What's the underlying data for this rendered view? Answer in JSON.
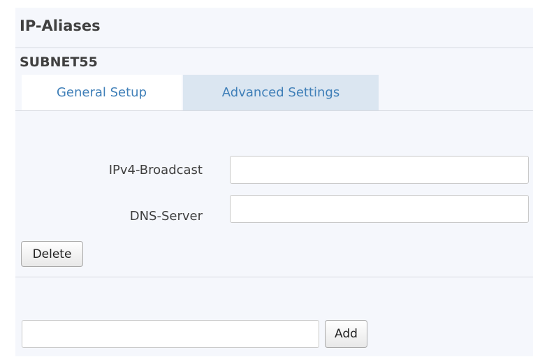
{
  "section": {
    "title": "IP-Aliases",
    "subsection_title": "SUBNET55"
  },
  "tabs": [
    {
      "label": "General Setup",
      "active": true
    },
    {
      "label": "Advanced Settings",
      "active": false
    }
  ],
  "fields": [
    {
      "label": "IPv4-Broadcast",
      "value": ""
    },
    {
      "label": "DNS-Server",
      "value": ""
    }
  ],
  "delete_button": "Delete",
  "add": {
    "value": "",
    "button": "Add"
  },
  "colors": {
    "panel_bg": "#f5f7fc",
    "tab_inactive_bg": "#dbe6f1",
    "tab_text": "#3f7fb8"
  }
}
